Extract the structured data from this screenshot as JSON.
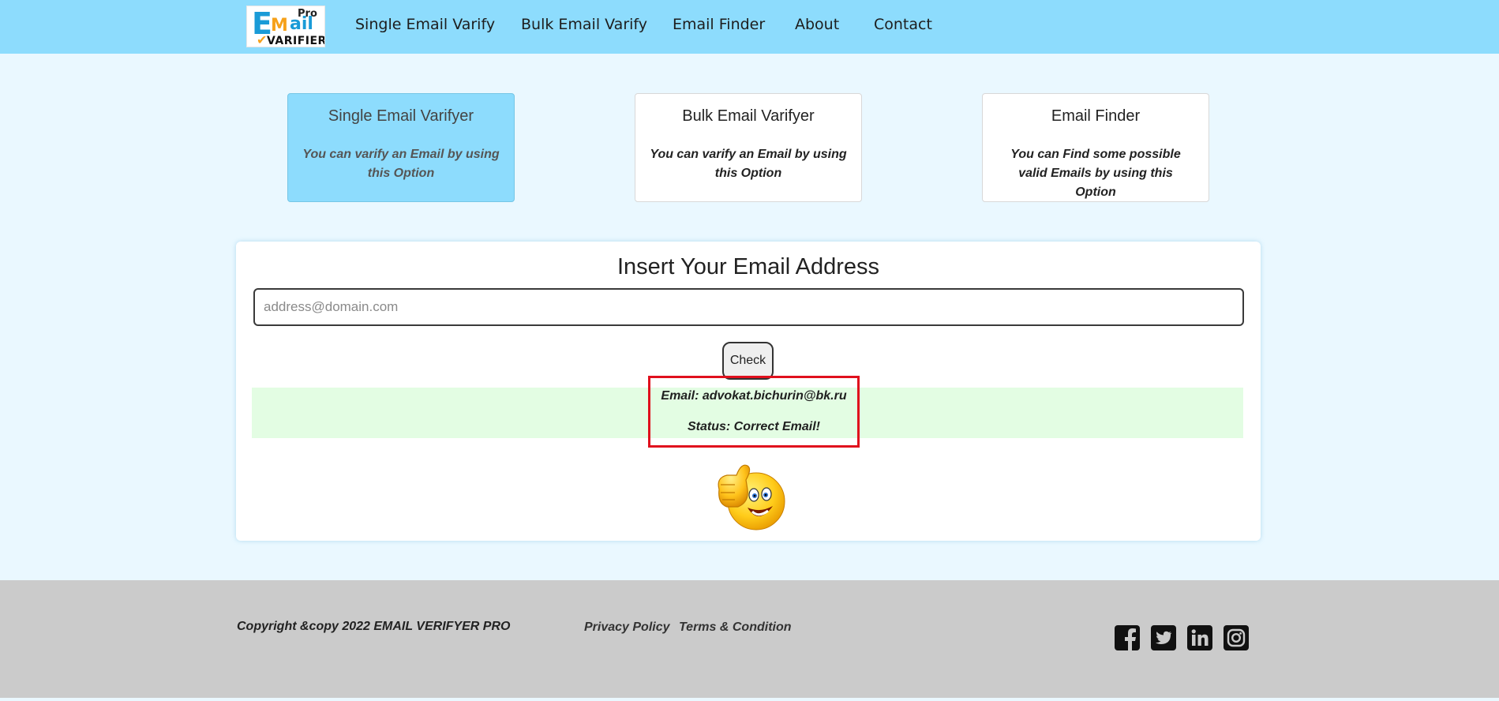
{
  "header": {
    "logo": {
      "e": "E",
      "m": "M",
      "ail": "ail",
      "pro": "Pro",
      "varifier": "VARIFIER"
    },
    "nav": [
      "Single Email Varify",
      "Bulk Email Varify",
      "Email Finder",
      "About",
      "Contact"
    ]
  },
  "options": [
    {
      "title": "Single Email Varifyer",
      "desc": "You can varify an Email by using this Option",
      "active": true
    },
    {
      "title": "Bulk Email Varifyer",
      "desc": "You can varify an Email by using this Option",
      "active": false
    },
    {
      "title": "Email Finder",
      "desc": "You can Find some possible valid Emails by using this Option",
      "active": false
    }
  ],
  "main": {
    "title": "Insert Your Email Address",
    "input_placeholder": "address@domain.com",
    "input_value": "",
    "check_label": "Check",
    "result_email": "Email: advokat.bichurin@bk.ru",
    "result_status": "Status: Correct Email!"
  },
  "footer": {
    "copyright": "Copyright &copy 2022 EMAIL VERIFYER PRO",
    "links": [
      "Privacy Policy",
      "Terms & Condition"
    ],
    "social_icons": [
      "facebook-icon",
      "twitter-icon",
      "linkedin-icon",
      "instagram-icon"
    ]
  },
  "colors": {
    "header_bg": "#8ddcfd",
    "page_bg": "#eaf8ff",
    "active_card_bg": "#8ddcfd",
    "result_bg": "#e3fde3",
    "highlight_border": "#e0101d",
    "footer_bg": "#cbcbcb"
  }
}
